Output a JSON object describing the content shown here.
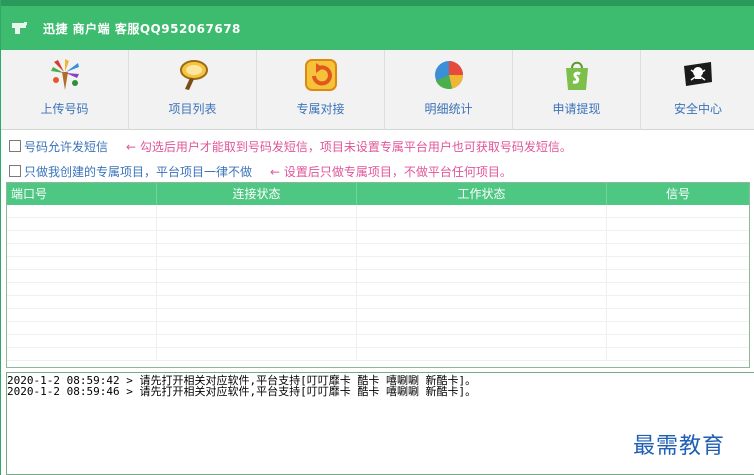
{
  "titlebar": {
    "title": "迅捷 商户端  客服QQ952067678",
    "icon": "pistol-icon"
  },
  "toolbar": {
    "items": [
      {
        "label": "上传号码",
        "icon": "fireworks-icon"
      },
      {
        "label": "项目列表",
        "icon": "magnifier-icon"
      },
      {
        "label": "专属对接",
        "icon": "refresh-arrow-icon"
      },
      {
        "label": "明细统计",
        "icon": "pie-chart-icon"
      },
      {
        "label": "申请提现",
        "icon": "shopping-bag-icon"
      },
      {
        "label": "安全中心",
        "icon": "pirate-flag-icon"
      }
    ]
  },
  "options": {
    "allow_sms": {
      "label": "号码允许发短信",
      "hint": "← 勾选后用户才能取到号码发短信，项目未设置专属平台用户也可获取号码发短信。",
      "checked": false
    },
    "only_exclusive": {
      "label": "只做我创建的专属项目，平台项目一律不做",
      "hint": "← 设置后只做专属项目，不做平台任何项目。",
      "checked": false
    }
  },
  "table": {
    "columns": [
      "端口号",
      "连接状态",
      "工作状态",
      "信号"
    ],
    "rows": []
  },
  "log": {
    "lines": [
      "2020-1-2 08:59:42 > 请先打开相关对应软件,平台支持[叮叮靡卡 酷卡 嘻唰唰 新酷卡]。",
      "2020-1-2 08:59:46 > 请先打开相关对应软件,平台支持[叮叮靡卡 酷卡 嘻唰唰 新酷卡]。"
    ]
  },
  "watermark": "最需教育",
  "colors": {
    "accent_green": "#3dbb6e",
    "header_green": "#4ec783",
    "label_blue": "#3b73b9",
    "hint_pink": "#e0559a"
  }
}
